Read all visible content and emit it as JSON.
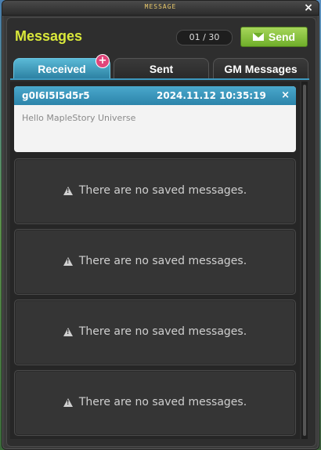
{
  "window": {
    "title": "MESSAGE",
    "close_label": "×"
  },
  "header": {
    "title": "Messages",
    "counter": "01 / 30",
    "send_label": "Send"
  },
  "tabs": [
    {
      "label": "Received",
      "active": true
    },
    {
      "label": "Sent",
      "active": false
    },
    {
      "label": "GM Messages",
      "active": false
    }
  ],
  "new_badge": "+",
  "message": {
    "sender": "g0I6I5I5d5r5",
    "date": "2024.11.12 10:35:19",
    "close_label": "×",
    "body": "Hello MapleStory Universe"
  },
  "empty_slots": [
    {
      "text": "There are no saved messages."
    },
    {
      "text": "There are no saved messages."
    },
    {
      "text": "There are no saved messages."
    },
    {
      "text": "There are no saved messages."
    }
  ],
  "colors": {
    "accent": "#2c84aa",
    "title": "#d9e83a",
    "send": "#6fae2a",
    "badge": "#e0457a"
  }
}
